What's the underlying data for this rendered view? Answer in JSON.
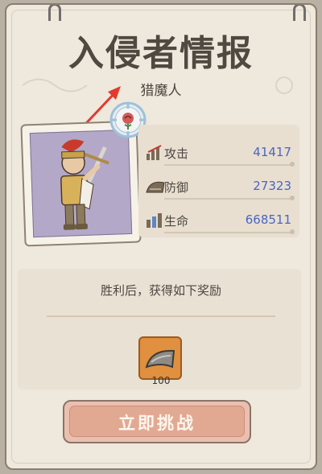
{
  "dialog": {
    "title": "入侵者情报",
    "enemy_name": "猎魔人",
    "stats": [
      {
        "label": "攻击",
        "value": "41417",
        "icon": "sword-attack-icon"
      },
      {
        "label": "防御",
        "value": "27323",
        "icon": "armor-defense-icon"
      },
      {
        "label": "生命",
        "value": "668511",
        "icon": "heart-health-icon"
      }
    ],
    "reward_caption": "胜利后，获得如下奖励",
    "reward": {
      "icon": "armor-piece-icon",
      "count": "100"
    },
    "challenge_button_label": "立即挑战"
  },
  "colors": {
    "stat_value": "#4a66c2",
    "button": "#e2a992",
    "portrait_bg": "#b3a8c8",
    "reward_tile": "#e0903e",
    "arrow": "#e23a2f"
  }
}
